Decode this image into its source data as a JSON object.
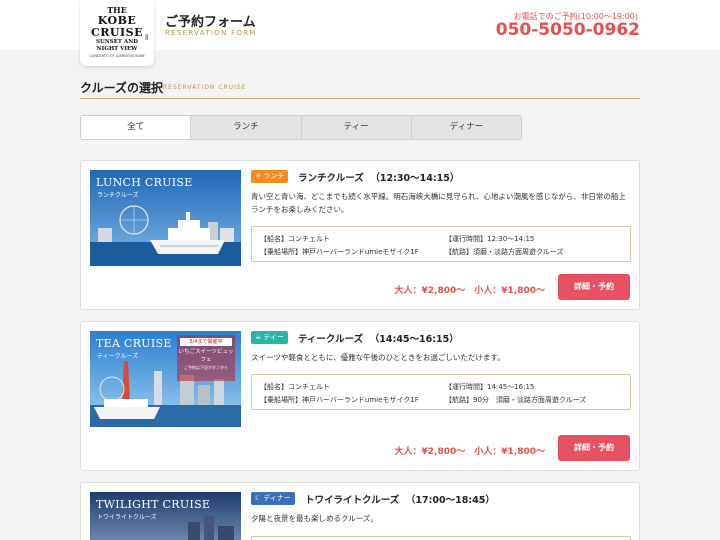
{
  "header": {
    "logo": {
      "l1": "THE",
      "l2a": "KOBE",
      "l2b": "CRUISE",
      "l3a": "SUNSET AND",
      "l3b": "NIGHT VIEW",
      "l4": "CONCERTO OF LUMINOUS KOBE"
    },
    "title": "ご予約フォーム",
    "subtitle": "RESERVATION FORM",
    "phone_label": "お電話でのご予約(10:00〜19:00)",
    "phone": "050-5050-0962"
  },
  "section": {
    "title": "クルーズの選択",
    "subtitle": "RESERVATION CRUISE"
  },
  "tabs": [
    {
      "label": "全て"
    },
    {
      "label": "ランチ"
    },
    {
      "label": "ティー"
    },
    {
      "label": "ディナー"
    }
  ],
  "cruises": [
    {
      "image_title": "LUNCH CRUISE",
      "image_sub": "ランチクルーズ",
      "badge": "ランチ",
      "badge_icon": "sun-icon",
      "badge_color": "#f28c1e",
      "name": "ランチクルーズ",
      "time": "（12:30〜14:15）",
      "description": "青い空と青い海、どこまでも続く水平線。明石海峡大橋に見守られ、心地よい潮風を感じながら、非日常の船上ランチをお楽しみください。",
      "ship": "【船名】コンチェルト",
      "boarding": "【乗船場所】神戸ハーバーランドumieモザイク1F",
      "operating": "【運行時間】12:30〜14:15",
      "route": "【航路】須磨・淡路方面周遊クルーズ",
      "price": "大人：¥2,800〜　小人：¥1,800〜",
      "button": "詳細・予約"
    },
    {
      "image_title": "TEA CRUISE",
      "image_sub": "ティークルーズ",
      "promo_top": "5/4まで開催中",
      "promo_body": "いちごスイーツビュッフェ",
      "promo_note": "ご予約は下記ボタンから",
      "badge": "ティー",
      "badge_icon": "cup-icon",
      "badge_color": "#2bb5a8",
      "name": "ティークルーズ",
      "time": "（14:45〜16:15）",
      "description": "スイーツや軽食とともに、優雅な午後のひとときをお過ごしいただけます。",
      "ship": "【船名】コンチェルト",
      "boarding": "【乗船場所】神戸ハーバーランドumieモザイク1F",
      "operating": "【運行時間】14:45〜16:15",
      "route": "【航路】90分　須磨・淡路方面周遊クルーズ",
      "price": "大人：¥2,800〜　小人：¥1,800〜",
      "button": "詳細・予約"
    },
    {
      "image_title": "TWILIGHT CRUISE",
      "image_sub": "トワイライトクルーズ",
      "badge": "ディナー",
      "badge_icon": "moon-icon",
      "badge_color": "#3b6fb6",
      "name": "トワイライトクルーズ",
      "time": "（17:00〜18:45）",
      "description": "夕陽と夜景を最も楽しめるクルーズ。"
    }
  ]
}
